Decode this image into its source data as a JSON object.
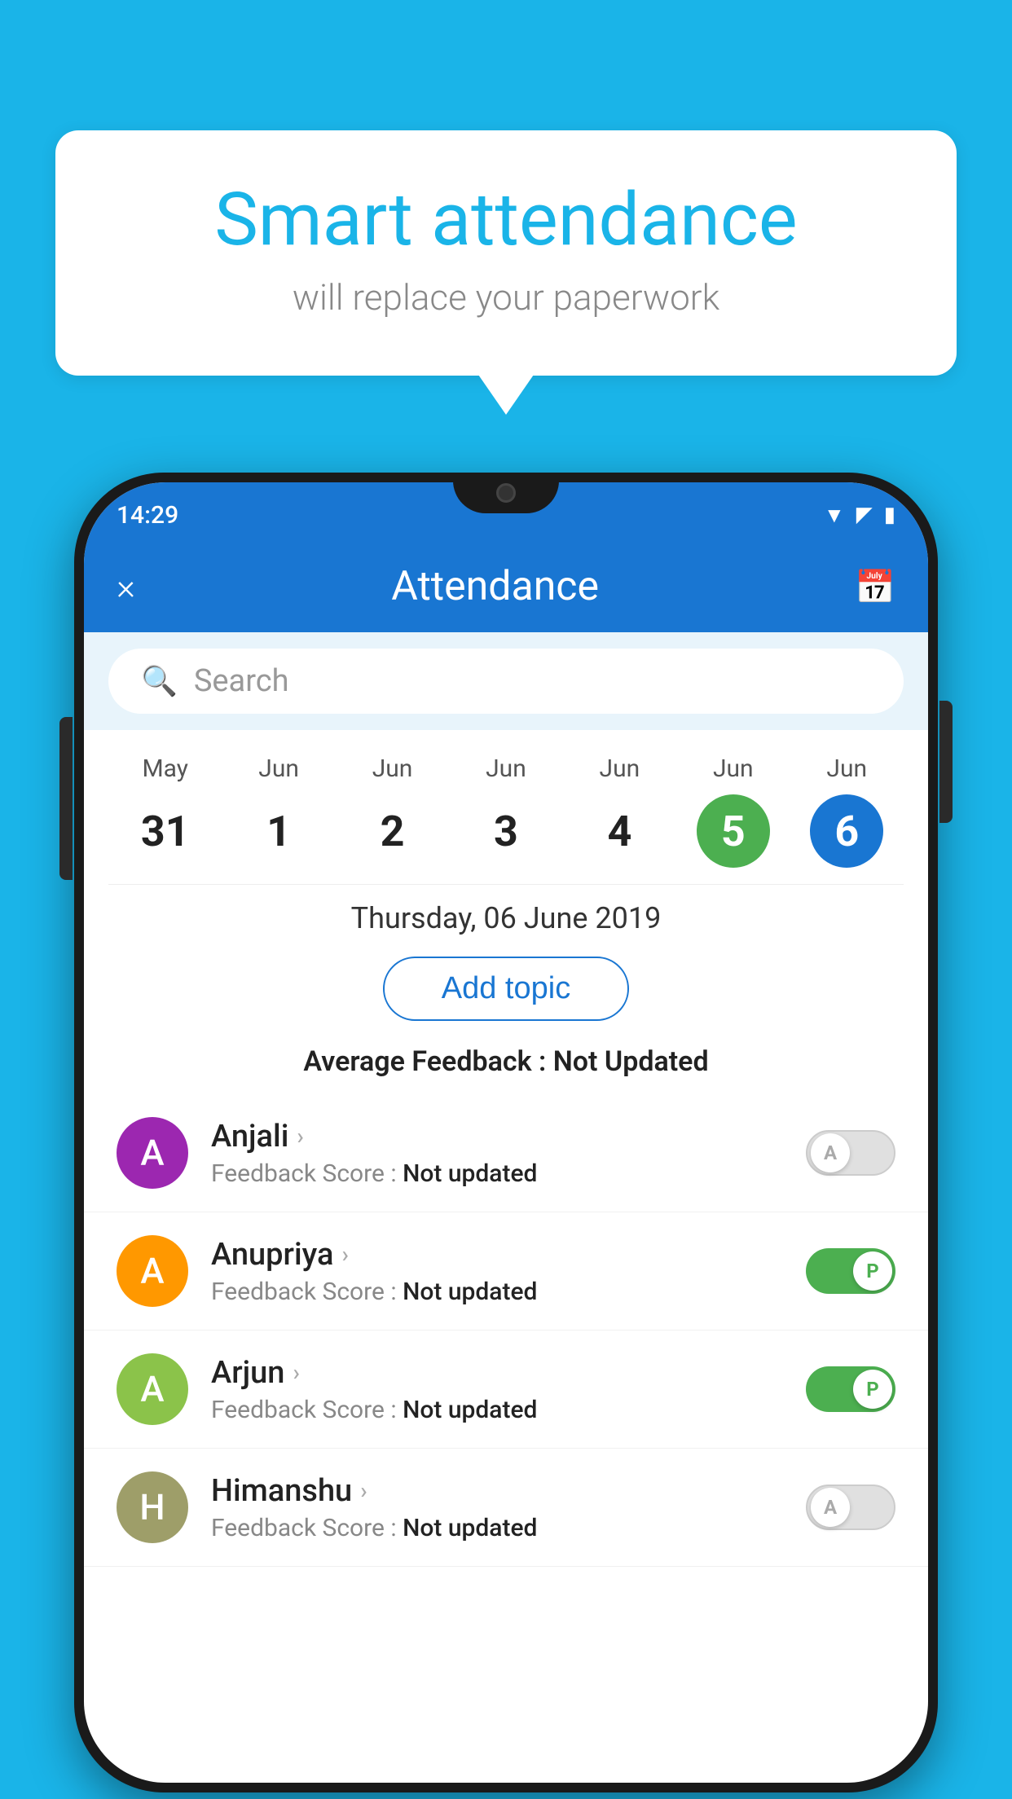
{
  "background_color": "#1ab4e8",
  "bubble": {
    "title": "Smart attendance",
    "subtitle": "will replace your paperwork"
  },
  "phone": {
    "status_bar": {
      "time": "14:29"
    },
    "header": {
      "title": "Attendance",
      "close_label": "×",
      "calendar_icon": "calendar-icon"
    },
    "search": {
      "placeholder": "Search"
    },
    "calendar": {
      "days": [
        {
          "month": "May",
          "num": "31",
          "state": "normal"
        },
        {
          "month": "Jun",
          "num": "1",
          "state": "normal"
        },
        {
          "month": "Jun",
          "num": "2",
          "state": "normal"
        },
        {
          "month": "Jun",
          "num": "3",
          "state": "normal"
        },
        {
          "month": "Jun",
          "num": "4",
          "state": "normal"
        },
        {
          "month": "Jun",
          "num": "5",
          "state": "today"
        },
        {
          "month": "Jun",
          "num": "6",
          "state": "selected"
        }
      ],
      "selected_date": "Thursday, 06 June 2019"
    },
    "add_topic_label": "Add topic",
    "average_feedback": {
      "label": "Average Feedback : ",
      "value": "Not Updated"
    },
    "students": [
      {
        "name": "Anjali",
        "avatar_letter": "A",
        "avatar_color": "purple",
        "feedback_label": "Feedback Score : ",
        "feedback_value": "Not updated",
        "toggle_state": "off",
        "toggle_label": "A"
      },
      {
        "name": "Anupriya",
        "avatar_letter": "A",
        "avatar_color": "orange",
        "feedback_label": "Feedback Score : ",
        "feedback_value": "Not updated",
        "toggle_state": "on-p",
        "toggle_label": "P"
      },
      {
        "name": "Arjun",
        "avatar_letter": "A",
        "avatar_color": "light-green",
        "feedback_label": "Feedback Score : ",
        "feedback_value": "Not updated",
        "toggle_state": "on-p",
        "toggle_label": "P"
      },
      {
        "name": "Himanshu",
        "avatar_letter": "H",
        "avatar_color": "olive",
        "feedback_label": "Feedback Score : ",
        "feedback_value": "Not updated",
        "toggle_state": "off",
        "toggle_label": "A"
      }
    ]
  }
}
